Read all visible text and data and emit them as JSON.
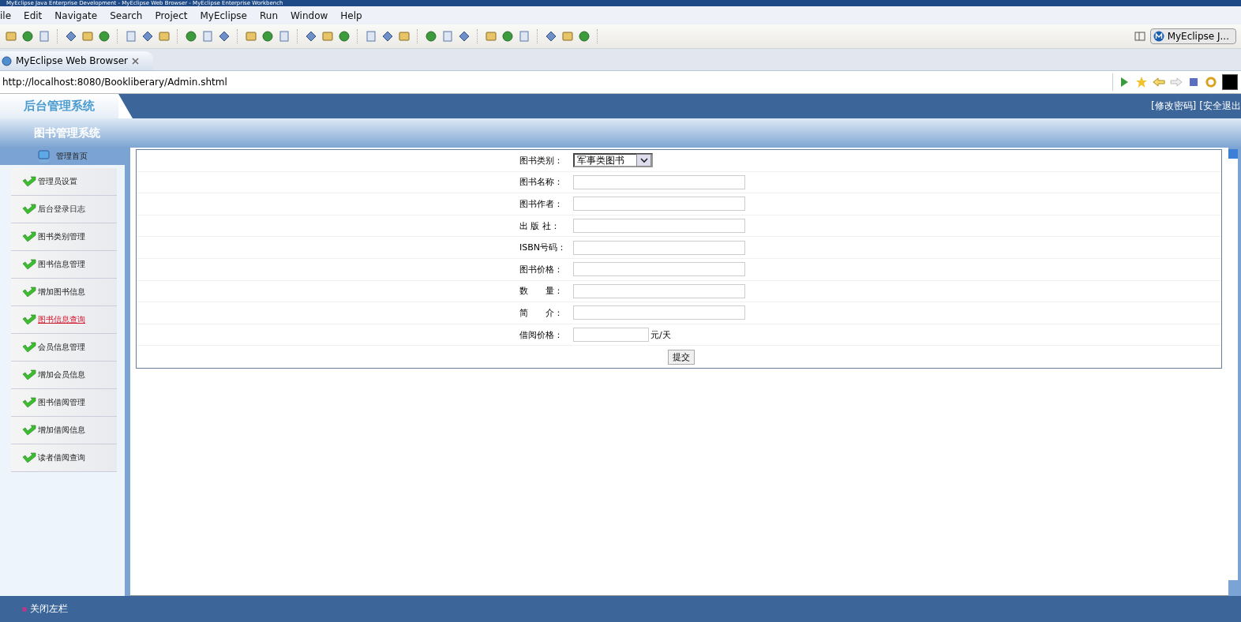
{
  "window": {
    "title": "MyEclipse Java Enterprise Development - MyEclipse Web Browser - MyEclipse Enterprise Workbench"
  },
  "menu": [
    "ile",
    "Edit",
    "Navigate",
    "Search",
    "Project",
    "MyEclipse",
    "Run",
    "Window",
    "Help"
  ],
  "perspective": {
    "label": "MyEclipse J..."
  },
  "editor_tab": {
    "label": "MyEclipse Web Browser"
  },
  "address": {
    "value": "http://localhost:8080/Bookliberary/Admin.shtml"
  },
  "page": {
    "logo": "后台管理系统",
    "header_links": [
      "[修改密码]",
      "[安全退出"
    ],
    "system_title": "图书管理系统",
    "sidebar": {
      "home": "管理首页",
      "items": [
        {
          "label": "管理员设置",
          "highlighted": false
        },
        {
          "label": "后台登录日志",
          "highlighted": false
        },
        {
          "label": "图书类别管理",
          "highlighted": false
        },
        {
          "label": "图书信息管理",
          "highlighted": false
        },
        {
          "label": "增加图书信息",
          "highlighted": false
        },
        {
          "label": "图书信息查询",
          "highlighted": true
        },
        {
          "label": "会员信息管理",
          "highlighted": false
        },
        {
          "label": "增加会员信息",
          "highlighted": false
        },
        {
          "label": "图书借阅管理",
          "highlighted": false
        },
        {
          "label": "增加借阅信息",
          "highlighted": false
        },
        {
          "label": "读者借阅查询",
          "highlighted": false
        }
      ]
    },
    "form": {
      "fields": [
        {
          "label": "图书类别：",
          "kind": "select",
          "value": "军事类图书"
        },
        {
          "label": "图书名称：",
          "kind": "text"
        },
        {
          "label": "图书作者：",
          "kind": "text"
        },
        {
          "label": "出 版 社：",
          "kind": "text"
        },
        {
          "label": "ISBN号码：",
          "kind": "text"
        },
        {
          "label": "图书价格：",
          "kind": "text"
        },
        {
          "label": "数　　量：",
          "kind": "text"
        },
        {
          "label": "简　　介：",
          "kind": "text"
        },
        {
          "label": "借阅价格：",
          "kind": "unit",
          "unit": "元/天"
        }
      ],
      "submit": "提交"
    },
    "footer": {
      "label": "关闭左栏"
    }
  }
}
